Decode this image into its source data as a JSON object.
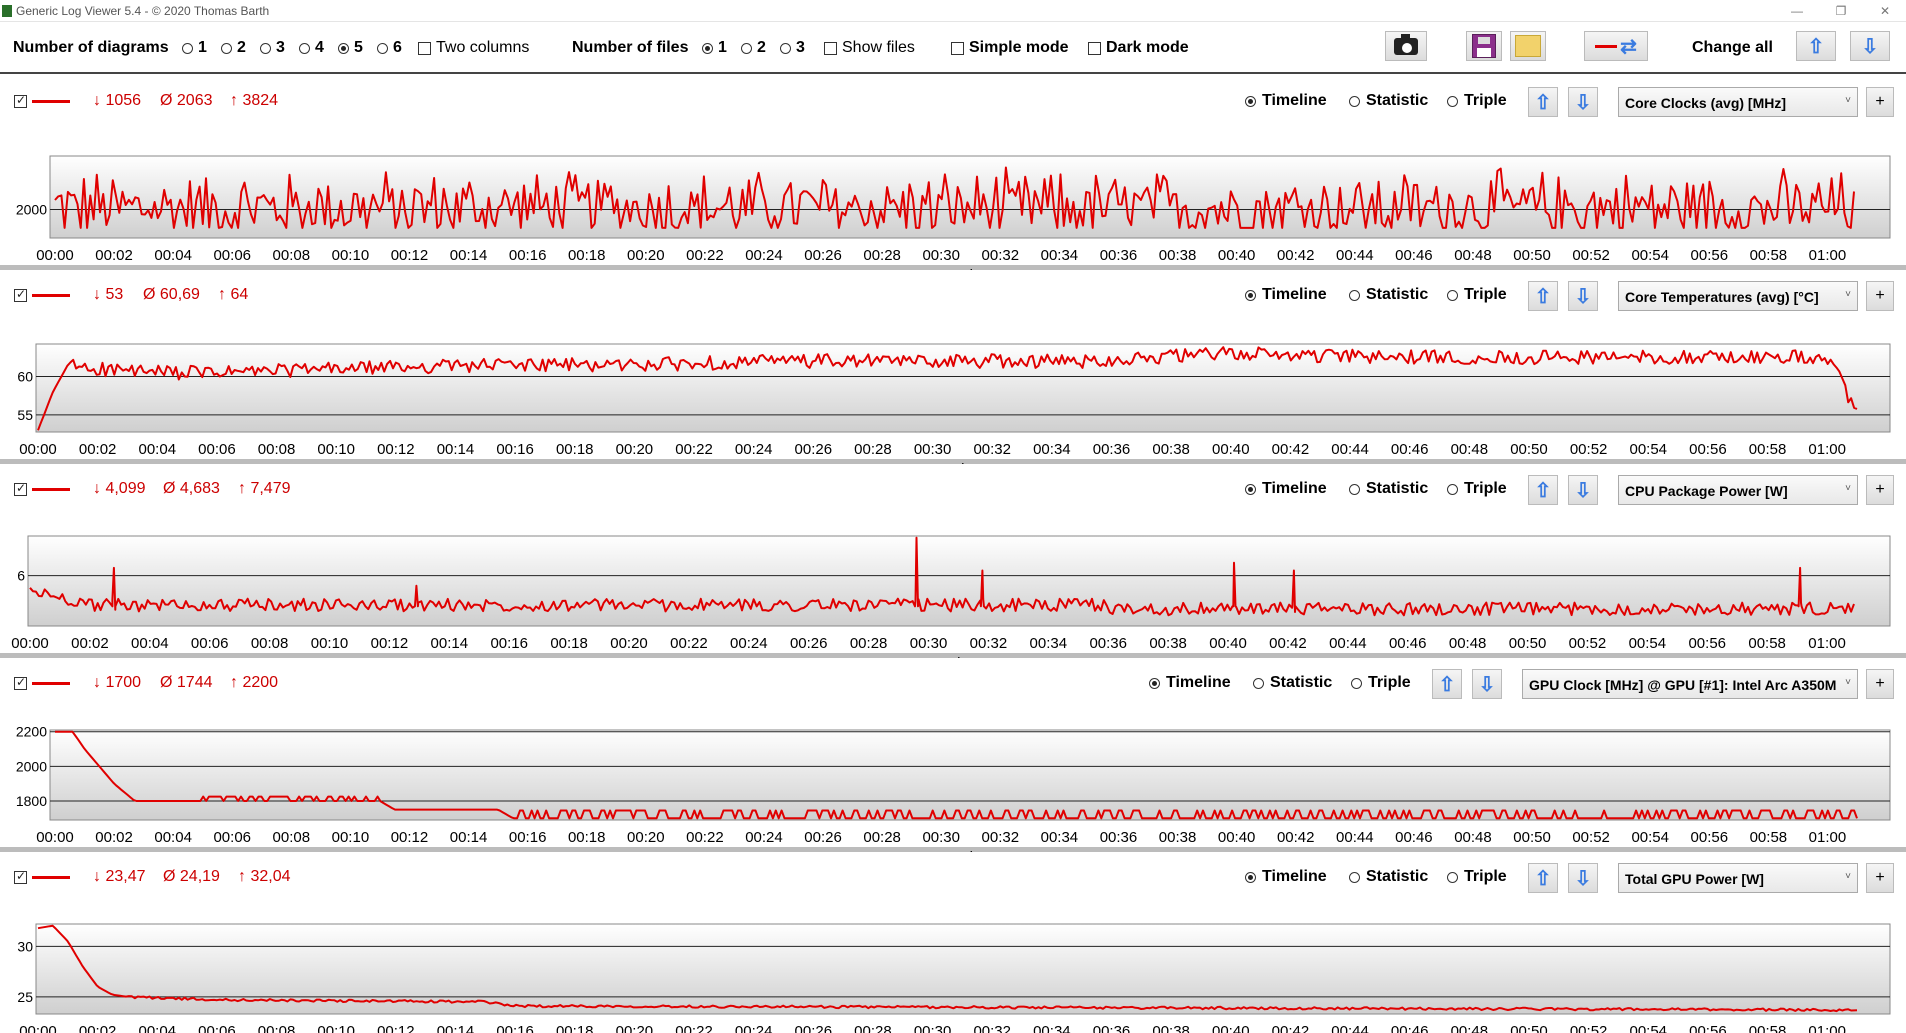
{
  "window": {
    "title": "Generic Log Viewer 5.4 - © 2020 Thomas Barth",
    "controls": [
      "—",
      "❐",
      "✕"
    ]
  },
  "toolbar": {
    "diagrams_label": "Number of diagrams",
    "diagram_options": [
      "1",
      "2",
      "3",
      "4",
      "5",
      "6"
    ],
    "diagrams_selected": "5",
    "two_columns_label": "Two columns",
    "files_label": "Number of files",
    "file_options": [
      "1",
      "2",
      "3"
    ],
    "files_selected": "1",
    "show_files_label": "Show files",
    "simple_mode_label": "Simple mode",
    "dark_mode_label": "Dark mode",
    "change_all_label": "Change all"
  },
  "common": {
    "view_options": [
      "Timeline",
      "Statistic",
      "Triple"
    ],
    "view_selected": "Timeline",
    "x_axis_title": "Time",
    "x_ticks": [
      "00:00",
      "00:02",
      "00:04",
      "00:06",
      "00:08",
      "00:10",
      "00:12",
      "00:14",
      "00:16",
      "00:18",
      "00:20",
      "00:22",
      "00:24",
      "00:26",
      "00:28",
      "00:30",
      "00:32",
      "00:34",
      "00:36",
      "00:38",
      "00:40",
      "00:42",
      "00:44",
      "00:46",
      "00:48",
      "00:50",
      "00:52",
      "00:54",
      "00:56",
      "00:58",
      "01:00"
    ],
    "line_color": "#e00000",
    "min_symbol": "↓",
    "avg_symbol": "Ø",
    "max_symbol": "↑"
  },
  "panels": [
    {
      "min": "1056",
      "avg": "2063",
      "max": "3824",
      "sensor": "Core Clocks (avg) [MHz]"
    },
    {
      "min": "53",
      "avg": "60,69",
      "max": "64",
      "sensor": "Core Temperatures (avg) [°C]"
    },
    {
      "min": "4,099",
      "avg": "4,683",
      "max": "7,479",
      "sensor": "CPU Package Power [W]"
    },
    {
      "min": "1700",
      "avg": "1744",
      "max": "2200",
      "sensor": "GPU Clock [MHz] @ GPU [#1]: Intel Arc A350M"
    },
    {
      "min": "23,47",
      "avg": "24,19",
      "max": "32,04",
      "sensor": "Total GPU Power [W]"
    }
  ],
  "chart_data": [
    {
      "type": "line",
      "xlabel": "Time",
      "x_range": [
        "00:00",
        "01:01"
      ],
      "yticks": [
        2000
      ],
      "ylim": [
        1056,
        3824
      ],
      "series": [
        {
          "name": "Core Clocks (avg) [MHz]",
          "min": 1056,
          "avg": 2063,
          "max": 3824,
          "pattern": "noise"
        }
      ]
    },
    {
      "type": "line",
      "xlabel": "Time",
      "x_range": [
        "00:00",
        "01:01"
      ],
      "yticks": [
        55,
        60
      ],
      "ylim": [
        53,
        64
      ],
      "series": [
        {
          "name": "Core Temperatures (avg) [°C]",
          "min": 53,
          "avg": 60.69,
          "max": 64,
          "points": [
            [
              0,
              53
            ],
            [
              0.5,
              58
            ],
            [
              1,
              61.5
            ],
            [
              2,
              61
            ],
            [
              4,
              60.5
            ],
            [
              6,
              60.5
            ],
            [
              10,
              61
            ],
            [
              15,
              61.5
            ],
            [
              20,
              61.5
            ],
            [
              25,
              62
            ],
            [
              30,
              62
            ],
            [
              35,
              62
            ],
            [
              40,
              63
            ],
            [
              45,
              62.5
            ],
            [
              50,
              62.5
            ],
            [
              55,
              62.5
            ],
            [
              59.5,
              62.5
            ],
            [
              60.3,
              61
            ],
            [
              61,
              55
            ]
          ]
        }
      ]
    },
    {
      "type": "line",
      "xlabel": "Time",
      "x_range": [
        "00:00",
        "01:01"
      ],
      "yticks": [
        6
      ],
      "ylim": [
        4.099,
        7.479
      ],
      "series": [
        {
          "name": "CPU Package Power [W]",
          "min": 4.099,
          "avg": 4.683,
          "max": 7.479,
          "spikes": [
            [
              2.8,
              6.3
            ],
            [
              12.9,
              5.6
            ],
            [
              29.6,
              7.479
            ],
            [
              31.8,
              6.2
            ],
            [
              40.2,
              6.5
            ],
            [
              42.2,
              6.2
            ],
            [
              59.1,
              6.3
            ]
          ]
        }
      ]
    },
    {
      "type": "line",
      "xlabel": "Time",
      "x_range": [
        "00:00",
        "01:01"
      ],
      "yticks": [
        1800,
        2000,
        2200
      ],
      "ylim": [
        1700,
        2200
      ],
      "series": [
        {
          "name": "GPU Clock [MHz] @ GPU [#1]: Intel Arc A350M",
          "min": 1700,
          "avg": 1744,
          "max": 2200,
          "points": [
            [
              0,
              2200
            ],
            [
              0.6,
              2200
            ],
            [
              1,
              2100
            ],
            [
              1.5,
              2000
            ],
            [
              2,
              1900
            ],
            [
              2.7,
              1800
            ],
            [
              11,
              1800
            ],
            [
              11.5,
              1750
            ],
            [
              15,
              1750
            ],
            [
              15.5,
              1700
            ],
            [
              61,
              1700
            ]
          ]
        }
      ]
    },
    {
      "type": "line",
      "xlabel": "Time",
      "x_range": [
        "00:00",
        "01:01"
      ],
      "yticks": [
        25,
        30
      ],
      "ylim": [
        23.47,
        32.04
      ],
      "series": [
        {
          "name": "Total GPU Power [W]",
          "min": 23.47,
          "avg": 24.19,
          "max": 32.04,
          "points": [
            [
              0,
              31.8
            ],
            [
              0.5,
              32.04
            ],
            [
              1,
              30.5
            ],
            [
              1.5,
              28
            ],
            [
              2,
              26
            ],
            [
              2.5,
              25.2
            ],
            [
              3,
              25
            ],
            [
              6,
              24.7
            ],
            [
              15,
              24.5
            ],
            [
              16,
              24.1
            ],
            [
              61,
              23.7
            ]
          ]
        }
      ]
    }
  ]
}
